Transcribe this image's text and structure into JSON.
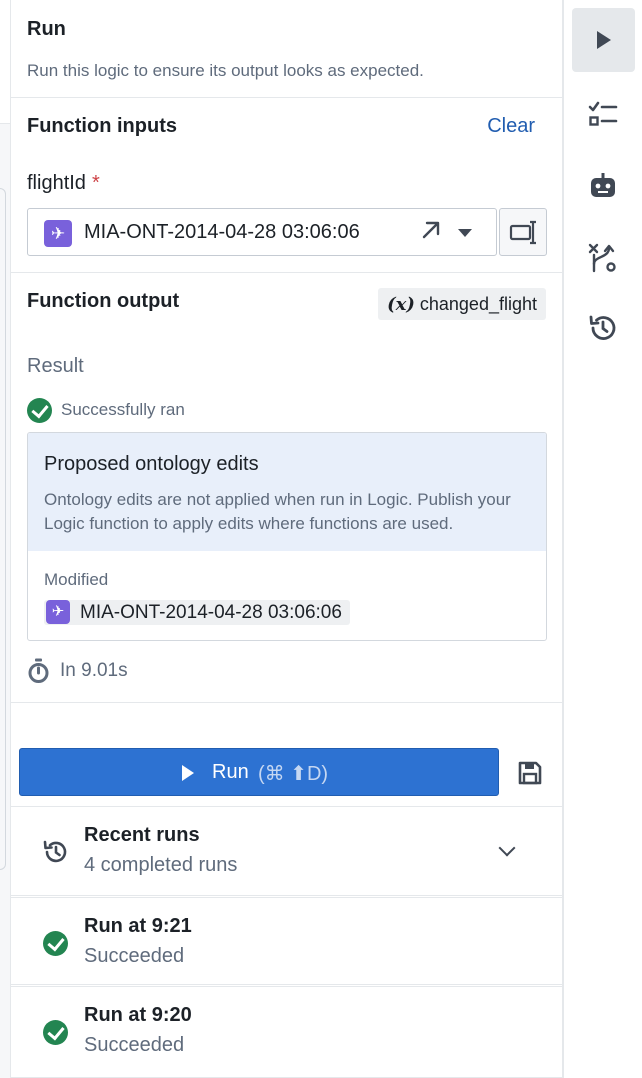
{
  "run_section": {
    "title": "Run",
    "subtitle": "Run this logic to ensure its output looks as expected."
  },
  "inputs": {
    "title": "Function inputs",
    "clear_label": "Clear",
    "field_label": "flightId",
    "required_mark": "*",
    "selected_value": "MIA-ONT-2014-04-28 03:06:06",
    "object_icon": "airplane-icon"
  },
  "output": {
    "title": "Function output",
    "variable_symbol": "(x)",
    "variable_name": "changed_flight",
    "result_label": "Result",
    "status_text": "Successfully ran",
    "edits_title": "Proposed ontology edits",
    "edits_desc": "Ontology edits are not applied when run in Logic. Publish your Logic function to apply edits where functions are used.",
    "modified_label": "Modified",
    "modified_value": "MIA-ONT-2014-04-28 03:06:06",
    "duration_text": "In 9.01s"
  },
  "run_button": {
    "label": "Run",
    "shortcut": "(⌘ ⬆D)"
  },
  "recent_runs": {
    "title": "Recent runs",
    "subtitle": "4 completed runs"
  },
  "runs": [
    {
      "title": "Run at 9:21",
      "status": "Succeeded"
    },
    {
      "title": "Run at 9:20",
      "status": "Succeeded"
    }
  ],
  "rail": {
    "items": [
      "play-icon",
      "checklist-icon",
      "robot-icon",
      "branch-icon",
      "history-icon"
    ],
    "active": "play-icon"
  },
  "colors": {
    "accent": "#2d72d2",
    "success": "#238551",
    "object": "#7961db",
    "link": "#215db0"
  }
}
